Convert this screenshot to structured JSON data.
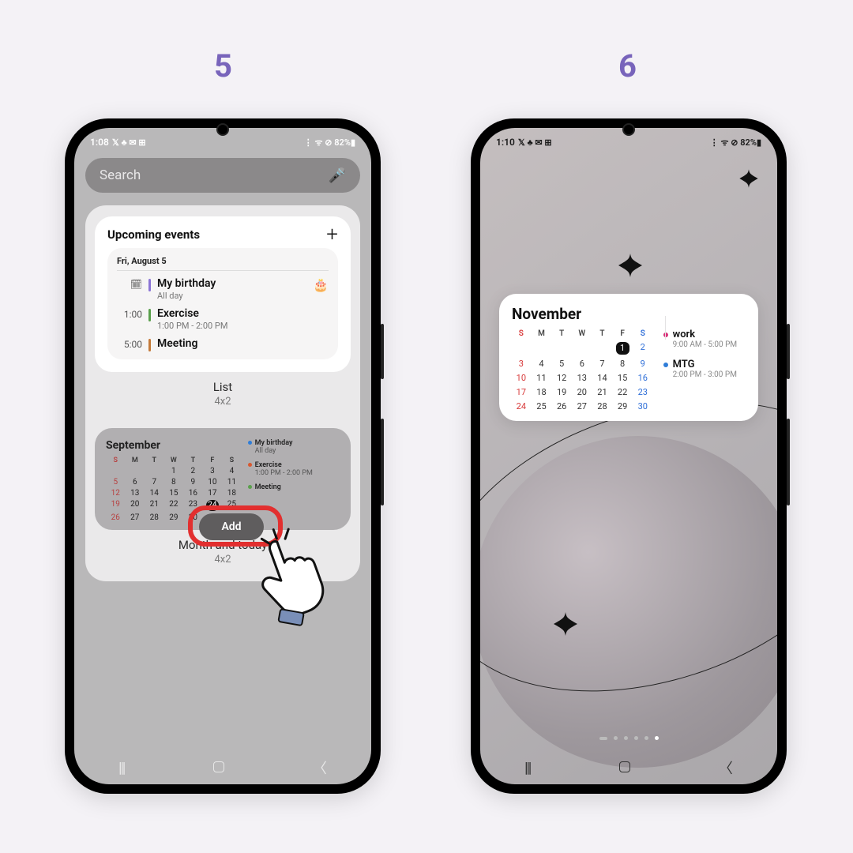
{
  "steps": {
    "s5": "5",
    "s6": "6"
  },
  "status1": {
    "time": "1:08",
    "icons": "𝕏 ♣ ✉ ⊞",
    "right": "⋮ ᯤ ⊘ 82%▮"
  },
  "status2": {
    "time": "1:10",
    "icons": "𝕏 ♣ ✉ ⊞",
    "right": "⋮ ᯤ ⊘ 82%▮"
  },
  "search": {
    "placeholder": "Search"
  },
  "widgetA": {
    "title": "Upcoming events",
    "date": "Fri, August 5",
    "events": [
      {
        "time_icon": "📅",
        "bar": "#8b74d6",
        "title": "My birthday",
        "sub": "All day",
        "emoji": "🎂"
      },
      {
        "time": "1:00",
        "bar": "#5aa04c",
        "title": "Exercise",
        "sub": "1:00 PM - 2:00 PM"
      },
      {
        "time": "5:00",
        "bar": "#c47a3a",
        "title": "Meeting",
        "sub": ""
      }
    ],
    "name": "List",
    "dim": "4x2"
  },
  "widgetB": {
    "month": "September",
    "dow": [
      "S",
      "M",
      "T",
      "W",
      "T",
      "F",
      "S"
    ],
    "weeks": [
      [
        "",
        "",
        "",
        "1",
        "2",
        "3",
        "4"
      ],
      [
        "5",
        "6",
        "7",
        "8",
        "9",
        "10",
        "11"
      ],
      [
        "12",
        "13",
        "14",
        "15",
        "16",
        "17",
        "18"
      ],
      [
        "19",
        "20",
        "21",
        "22",
        "23",
        "24",
        "25"
      ],
      [
        "26",
        "27",
        "28",
        "29",
        "30",
        "",
        ""
      ]
    ],
    "sel": "24",
    "events": [
      {
        "dot": "#2f7dd8",
        "title": "My birthday",
        "sub": "All day"
      },
      {
        "dot": "#d8582f",
        "title": "Exercise",
        "sub": "1:00 PM - 2:00 PM"
      },
      {
        "dot": "#5aa04c",
        "title": "Meeting",
        "sub": ""
      }
    ],
    "name": "Month and today",
    "dim": "4x2",
    "add": "Add"
  },
  "homeWidget": {
    "month": "November",
    "dow": [
      "S",
      "M",
      "T",
      "W",
      "T",
      "F",
      "S"
    ],
    "weeks": [
      [
        "",
        "",
        "",
        "",
        "",
        "1",
        "2"
      ],
      [
        "3",
        "4",
        "5",
        "6",
        "7",
        "8",
        "9"
      ],
      [
        "10",
        "11",
        "12",
        "13",
        "14",
        "15",
        "16"
      ],
      [
        "17",
        "18",
        "19",
        "20",
        "21",
        "22",
        "23"
      ],
      [
        "24",
        "25",
        "26",
        "27",
        "28",
        "29",
        "30"
      ]
    ],
    "sel": "1",
    "events": [
      {
        "dot": "#d8337a",
        "title": "work",
        "sub": "9:00 AM - 5:00 PM"
      },
      {
        "dot": "#2f7dd8",
        "title": "MTG",
        "sub": "2:00 PM - 3:00 PM"
      }
    ]
  }
}
